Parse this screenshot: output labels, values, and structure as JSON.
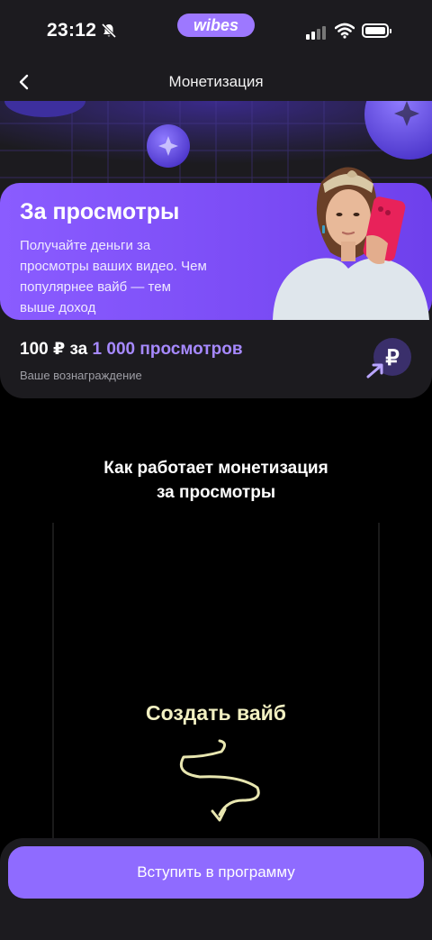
{
  "status_bar": {
    "time": "23:12",
    "app_pill": "wibes"
  },
  "nav": {
    "title": "Монетизация"
  },
  "banner": {
    "title": "За просмотры",
    "description": "Получайте деньги за просмотры ваших видео. Чем популярнее вайб — тем выше доход"
  },
  "reward": {
    "amount": "100 ₽ за",
    "views": "1 000 просмотров",
    "caption": "Ваше вознаграждение"
  },
  "how_it_works": {
    "title_line1": "Как работает монетизация",
    "title_line2": "за просмотры"
  },
  "video": {
    "caption": "Создать вайб"
  },
  "cta": {
    "label": "Вступить в программу"
  },
  "colors": {
    "accent": "#8f6bff",
    "banner": "#7b4cf5",
    "background": "#000000",
    "card": "#1c1b1f",
    "caption_yellow": "#f2f0c2"
  }
}
